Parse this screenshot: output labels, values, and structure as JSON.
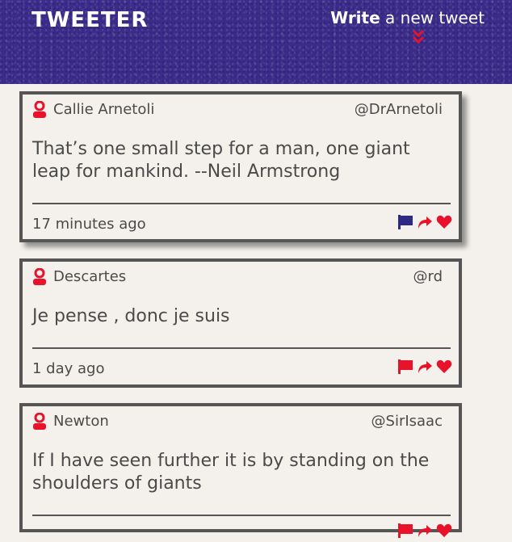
{
  "nav": {
    "logo": "TWEETER",
    "compose_bold": "Write",
    "compose_rest": " a new tweet"
  },
  "colors": {
    "nav_bg": "#3b2c8c",
    "accent_red": "#e8132b",
    "flag_blue": "#2c2a86",
    "card_border": "#555555",
    "page_bg": "#f4f1ec"
  },
  "tweets": [
    {
      "name": "Callie Arnetoli",
      "handle": "@DrArnetoli",
      "content": "That’s one small step for a man, one giant leap for mankind. --Neil Armstrong",
      "time": "17 minutes ago",
      "flag_color": "blue",
      "icons": [
        "user-icon",
        "flag-icon",
        "retweet-icon",
        "heart-icon"
      ]
    },
    {
      "name": "Descartes",
      "handle": "@rd",
      "content": "Je pense , donc je suis",
      "time": "1 day ago",
      "flag_color": "red",
      "icons": [
        "user-icon",
        "flag-icon",
        "retweet-icon",
        "heart-icon"
      ]
    },
    {
      "name": "Newton",
      "handle": "@SirIsaac",
      "content": "If I have seen further it is by standing on the shoulders of giants",
      "time": "",
      "flag_color": "red",
      "icons": [
        "user-icon",
        "flag-icon",
        "retweet-icon",
        "heart-icon"
      ]
    }
  ]
}
